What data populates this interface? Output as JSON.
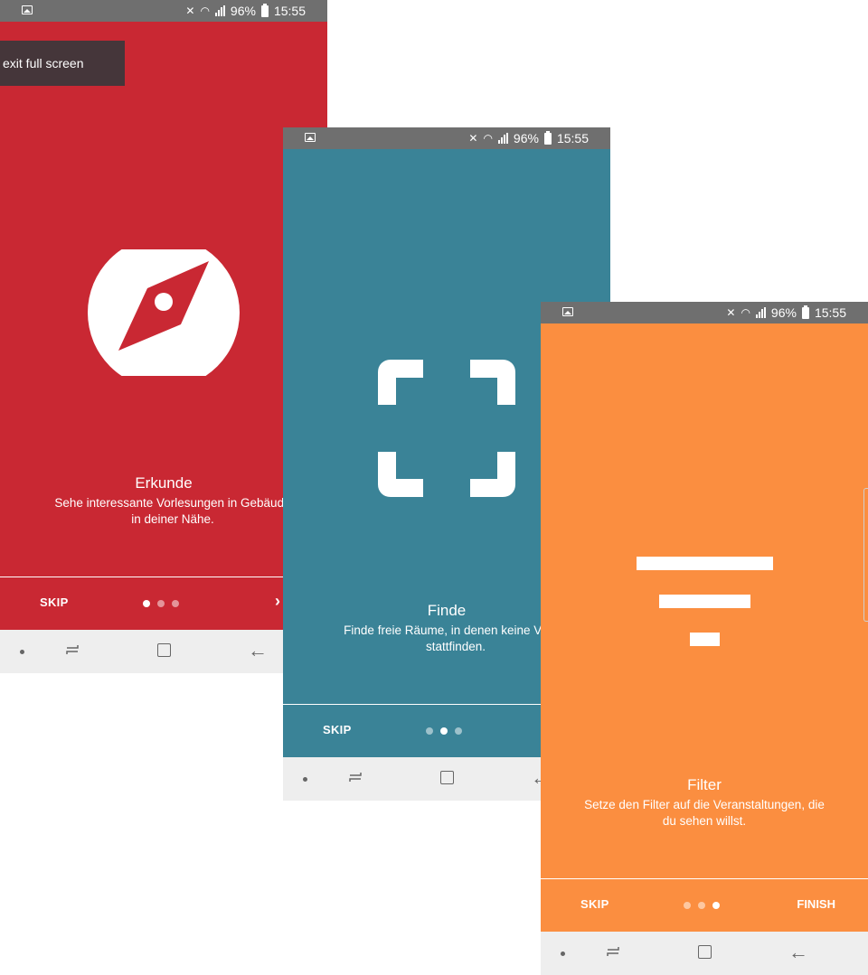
{
  "status": {
    "percent": "96%",
    "time": "15:55"
  },
  "tooltip": {
    "label": "exit full screen"
  },
  "screens": [
    {
      "id": "explore",
      "bg": "#c92833",
      "title": "Erkunde",
      "description": "Sehe interessante Vorlesungen in Gebäude\nin deiner Nähe.",
      "skip": "SKIP",
      "next": "›",
      "active_dot": 0
    },
    {
      "id": "find",
      "bg": "#3a8397",
      "title": "Finde",
      "description": "Finde freie Räume, in denen keine Vorles\nstattfinden.",
      "skip": "SKIP",
      "active_dot": 1
    },
    {
      "id": "filter",
      "bg": "#fb8e40",
      "title": "Filter",
      "description": "Setze den Filter auf die Veranstaltungen, die\ndu sehen willst.",
      "skip": "SKIP",
      "finish": "FINISH",
      "active_dot": 2
    }
  ],
  "icons": [
    "compass-icon",
    "scan-frame-icon",
    "filter-icon"
  ]
}
